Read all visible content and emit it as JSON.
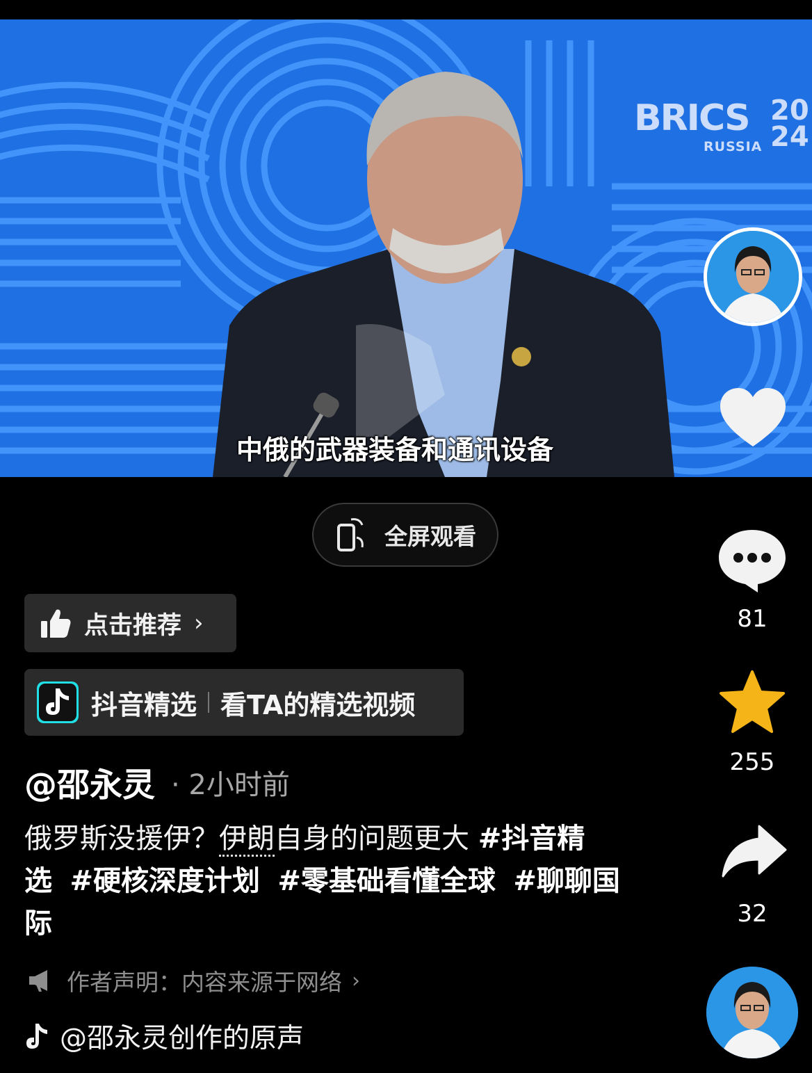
{
  "video": {
    "subtitle": "中俄的武器装备和通讯设备",
    "background_logo": "BRICS",
    "background_logo_sub": "RUSSIA",
    "background_logo_year": "20\n24",
    "accent_color": "#1e6fe0"
  },
  "fullscreen_button": {
    "label": "全屏观看",
    "icon": "rotate-phone-icon"
  },
  "recommend_button": {
    "label": "点击推荐",
    "icon": "thumbs-up-icon"
  },
  "selected_banner": {
    "brand": "抖音精选",
    "link": "看TA的精选视频",
    "icon": "douyin-logo-icon"
  },
  "post": {
    "author": "@邵永灵",
    "time": "· 2小时前",
    "caption_plain_1": "俄罗斯没援伊？",
    "caption_keyword": "伊朗",
    "caption_plain_2": "自身的问题更大 ",
    "tags": [
      "#抖音精选",
      "#硬核深度计划",
      "#零基础看懂全球",
      "#聊聊国际"
    ],
    "statement": "作者声明：内容来源于网络",
    "sound": "@邵永灵创作的原声"
  },
  "actions": {
    "likes_icon": "heart-icon",
    "comments": "81",
    "favorites": "255",
    "shares": "32",
    "favorite_color": "#f5b417"
  }
}
